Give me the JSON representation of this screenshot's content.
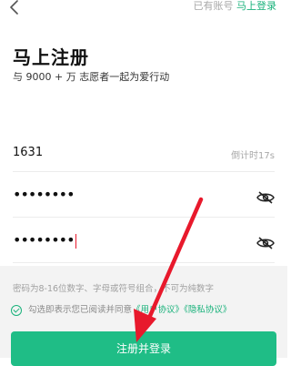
{
  "header": {
    "have_account": "已有账号",
    "login_link": "马上登录"
  },
  "page": {
    "title": "马上注册",
    "subtitle": "与 9000 + 万 志愿者一起为爱行动"
  },
  "form": {
    "code_value": "1631",
    "countdown": "倒计时17s",
    "password_dots": "••••••••",
    "confirm_password_dots": "••••••••",
    "hint": "密码为8-16位数字、字母或符号组合，不可为纯数字",
    "agree_prefix": "勾选即表示您已阅读并同意",
    "user_agreement": "《用户协议》",
    "privacy_agreement": "《隐私协议》",
    "submit_label": "注册并登录"
  },
  "colors": {
    "accent": "#19b27b",
    "button": "#1fbd86",
    "annotation_arrow": "#e8192c"
  },
  "icons": {
    "back": "back-chevron-icon",
    "eye": "eye-hidden-icon"
  }
}
